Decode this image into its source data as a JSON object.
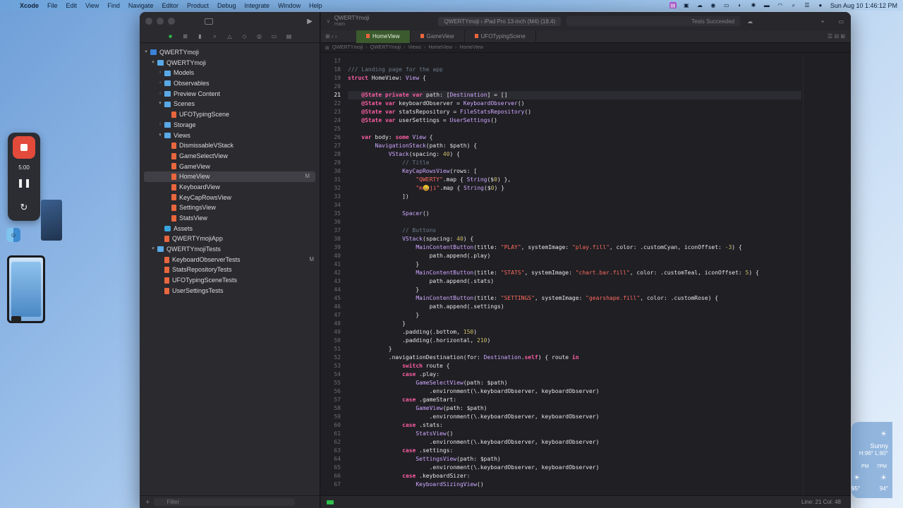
{
  "menubar": {
    "app": "Xcode",
    "items": [
      "File",
      "Edit",
      "View",
      "Find",
      "Navigate",
      "Editor",
      "Product",
      "Debug",
      "Integrate",
      "Window",
      "Help"
    ],
    "clock": "Sun Aug 10  1:46:12 PM"
  },
  "navigator": {
    "filter_placeholder": "Filter",
    "tree": [
      {
        "label": "QWERTYmoji",
        "level": 0,
        "kind": "proj",
        "disclosure": "▾",
        "badge": ""
      },
      {
        "label": "QWERTYmoji",
        "level": 1,
        "kind": "folder",
        "disclosure": "▾",
        "badge": ""
      },
      {
        "label": "Models",
        "level": 2,
        "kind": "folder",
        "disclosure": "›",
        "badge": ""
      },
      {
        "label": "Observables",
        "level": 2,
        "kind": "folder",
        "disclosure": "›",
        "badge": ""
      },
      {
        "label": "Preview Content",
        "level": 2,
        "kind": "folder",
        "disclosure": "›",
        "badge": ""
      },
      {
        "label": "Scenes",
        "level": 2,
        "kind": "folder",
        "disclosure": "▾",
        "badge": ""
      },
      {
        "label": "UFOTypingScene",
        "level": 3,
        "kind": "swift",
        "disclosure": "",
        "badge": ""
      },
      {
        "label": "Storage",
        "level": 2,
        "kind": "folder",
        "disclosure": "›",
        "badge": ""
      },
      {
        "label": "Views",
        "level": 2,
        "kind": "folder",
        "disclosure": "▾",
        "badge": ""
      },
      {
        "label": "DismissableVStack",
        "level": 3,
        "kind": "swift",
        "disclosure": "",
        "badge": ""
      },
      {
        "label": "GameSelectView",
        "level": 3,
        "kind": "swift",
        "disclosure": "",
        "badge": ""
      },
      {
        "label": "GameView",
        "level": 3,
        "kind": "swift",
        "disclosure": "",
        "badge": ""
      },
      {
        "label": "HomeView",
        "level": 3,
        "kind": "swift",
        "disclosure": "",
        "badge": "M",
        "selected": true
      },
      {
        "label": "KeyboardView",
        "level": 3,
        "kind": "swift",
        "disclosure": "",
        "badge": ""
      },
      {
        "label": "KeyCapRowsView",
        "level": 3,
        "kind": "swift",
        "disclosure": "",
        "badge": ""
      },
      {
        "label": "SettingsView",
        "level": 3,
        "kind": "swift",
        "disclosure": "",
        "badge": ""
      },
      {
        "label": "StatsView",
        "level": 3,
        "kind": "swift",
        "disclosure": "",
        "badge": ""
      },
      {
        "label": "Assets",
        "level": 2,
        "kind": "assets",
        "disclosure": "",
        "badge": ""
      },
      {
        "label": "QWERTYmojiApp",
        "level": 2,
        "kind": "swift",
        "disclosure": "",
        "badge": ""
      },
      {
        "label": "QWERTYmojiTests",
        "level": 1,
        "kind": "folder",
        "disclosure": "▾",
        "badge": ""
      },
      {
        "label": "KeyboardObserverTests",
        "level": 2,
        "kind": "swift",
        "disclosure": "",
        "badge": "M"
      },
      {
        "label": "StatsRepositoryTests",
        "level": 2,
        "kind": "swift",
        "disclosure": "",
        "badge": ""
      },
      {
        "label": "UFOTypingSceneTests",
        "level": 2,
        "kind": "swift",
        "disclosure": "",
        "badge": ""
      },
      {
        "label": "UserSettingsTests",
        "level": 2,
        "kind": "swift",
        "disclosure": "",
        "badge": ""
      }
    ]
  },
  "toolbar": {
    "project": "QWERTYmoji",
    "branch": "main",
    "scheme": "QWERTYmoji  ›  iPad Pro 13-inch (M4) (18.4)",
    "status": "Tests Succeeded"
  },
  "tabs": [
    {
      "label": "HomeView",
      "active": true
    },
    {
      "label": "GameView",
      "active": false
    },
    {
      "label": "UFOTypingScene",
      "active": false
    }
  ],
  "jumpbar": [
    "QWERTYmoji",
    "QWERTYmoji",
    "Views",
    "HomeView",
    "HomeView"
  ],
  "editor": {
    "current_line": 21,
    "lines": [
      {
        "n": 17,
        "code": ""
      },
      {
        "n": 18,
        "code": "/// Landing page for the app"
      },
      {
        "n": 19,
        "code": "struct HomeView: View {"
      },
      {
        "n": 20,
        "code": ""
      },
      {
        "n": 21,
        "code": "    @State private var path: [Destination] = []"
      },
      {
        "n": 22,
        "code": "    @State var keyboardObserver = KeyboardObserver()"
      },
      {
        "n": 23,
        "code": "    @State var statsRepository = FileStatsRepository()"
      },
      {
        "n": 24,
        "code": "    @State var userSettings = UserSettings()"
      },
      {
        "n": 25,
        "code": ""
      },
      {
        "n": 26,
        "code": "    var body: some View {"
      },
      {
        "n": 27,
        "code": "        NavigationStack(path: $path) {"
      },
      {
        "n": 28,
        "code": "            VStack(spacing: 40) {"
      },
      {
        "n": 29,
        "code": "                // Title"
      },
      {
        "n": 30,
        "code": "                KeyCapRowsView(rows: ["
      },
      {
        "n": 31,
        "code": "                    \"QWERTY\".map { String($0) },"
      },
      {
        "n": 32,
        "code": "                    \"m😀ji\".map { String($0) }"
      },
      {
        "n": 33,
        "code": "                ])"
      },
      {
        "n": 34,
        "code": ""
      },
      {
        "n": 35,
        "code": "                Spacer()"
      },
      {
        "n": 36,
        "code": ""
      },
      {
        "n": 37,
        "code": "                // Buttons"
      },
      {
        "n": 38,
        "code": "                VStack(spacing: 40) {"
      },
      {
        "n": 39,
        "code": "                    MainContentButton(title: \"PLAY\", systemImage: \"play.fill\", color: .customCyan, iconOffset: -3) {"
      },
      {
        "n": 40,
        "code": "                        path.append(.play)"
      },
      {
        "n": 41,
        "code": "                    }"
      },
      {
        "n": 42,
        "code": "                    MainContentButton(title: \"STATS\", systemImage: \"chart.bar.fill\", color: .customTeal, iconOffset: 5) {"
      },
      {
        "n": 43,
        "code": "                        path.append(.stats)"
      },
      {
        "n": 44,
        "code": "                    }"
      },
      {
        "n": 45,
        "code": "                    MainContentButton(title: \"SETTINGS\", systemImage: \"gearshape.fill\", color: .customRose) {"
      },
      {
        "n": 46,
        "code": "                        path.append(.settings)"
      },
      {
        "n": 47,
        "code": "                    }"
      },
      {
        "n": 48,
        "code": "                }"
      },
      {
        "n": 49,
        "code": "                .padding(.bottom, 150)"
      },
      {
        "n": 50,
        "code": "                .padding(.horizontal, 210)"
      },
      {
        "n": 51,
        "code": "            }"
      },
      {
        "n": 52,
        "code": "            .navigationDestination(for: Destination.self) { route in"
      },
      {
        "n": 53,
        "code": "                switch route {"
      },
      {
        "n": 54,
        "code": "                case .play:"
      },
      {
        "n": 55,
        "code": "                    GameSelectView(path: $path)"
      },
      {
        "n": 56,
        "code": "                        .environment(\\.keyboardObserver, keyboardObserver)"
      },
      {
        "n": 57,
        "code": "                case .gameStart:"
      },
      {
        "n": 58,
        "code": "                    GameView(path: $path)"
      },
      {
        "n": 59,
        "code": "                        .environment(\\.keyboardObserver, keyboardObserver)"
      },
      {
        "n": 60,
        "code": "                case .stats:"
      },
      {
        "n": 61,
        "code": "                    StatsView()"
      },
      {
        "n": 62,
        "code": "                        .environment(\\.keyboardObserver, keyboardObserver)"
      },
      {
        "n": 63,
        "code": "                case .settings:"
      },
      {
        "n": 64,
        "code": "                    SettingsView(path: $path)"
      },
      {
        "n": 65,
        "code": "                        .environment(\\.keyboardObserver, keyboardObserver)"
      },
      {
        "n": 66,
        "code": "                case .keyboardSizer:"
      },
      {
        "n": 67,
        "code": "                    KeyboardSizingView()"
      }
    ]
  },
  "statusbar": {
    "position": "Line: 21  Col: 48"
  },
  "recorder": {
    "time": "5:00"
  },
  "weather": {
    "condition": "Sunny",
    "high_low": "H:96° L:80°",
    "hour1": "PM",
    "hour2": "7PM",
    "temp1": "95°",
    "temp2": "94°"
  },
  "colors": {
    "accent_green": "#2fbf4b",
    "selected_tab": "#3b5a2e",
    "keyword": "#fc5fa3",
    "string": "#fc6a5d",
    "number": "#d0bf69",
    "comment": "#6c7986"
  }
}
